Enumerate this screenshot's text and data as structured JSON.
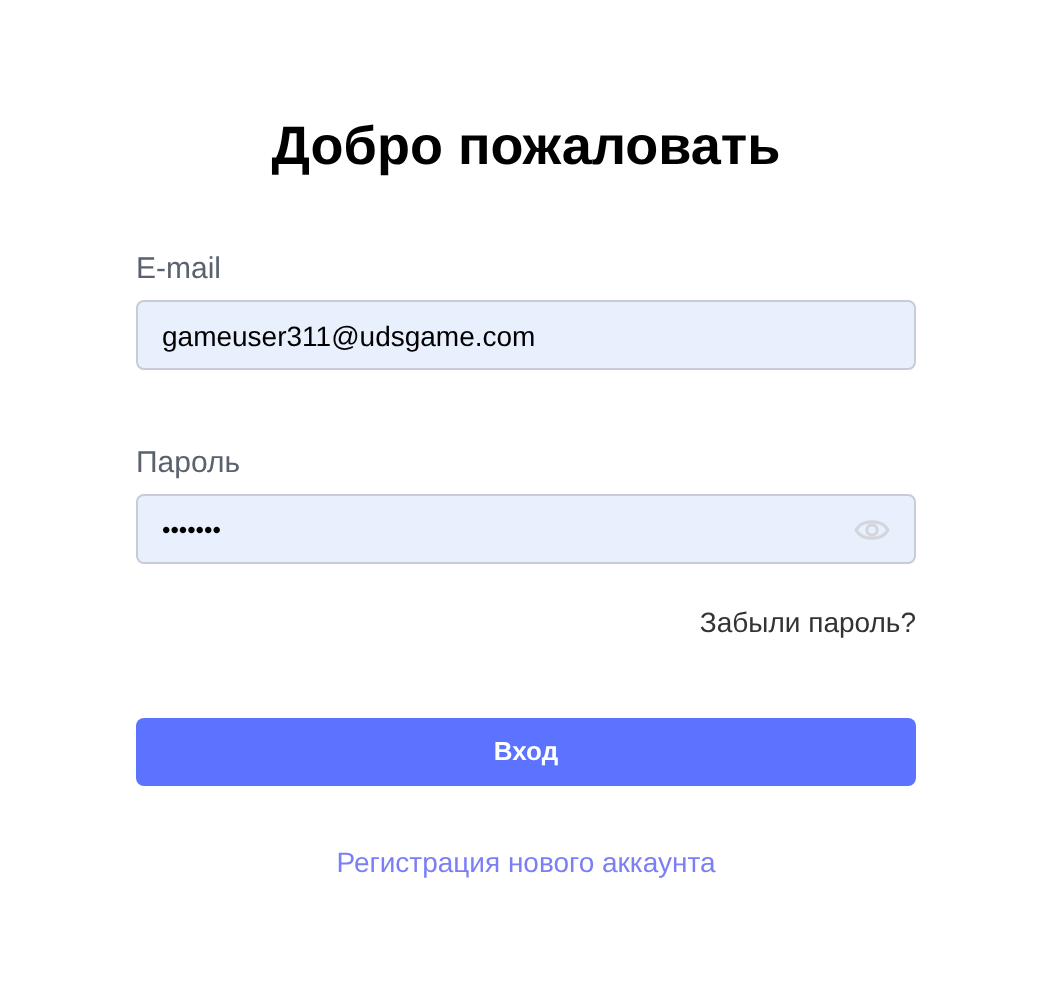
{
  "title": "Добро пожаловать",
  "email": {
    "label": "E-mail",
    "value": "gameuser311@udsgame.com"
  },
  "password": {
    "label": "Пароль",
    "value": "•••••••"
  },
  "forgot_link": "Забыли пароль?",
  "login_button": "Вход",
  "register_link": "Регистрация нового аккаунта"
}
